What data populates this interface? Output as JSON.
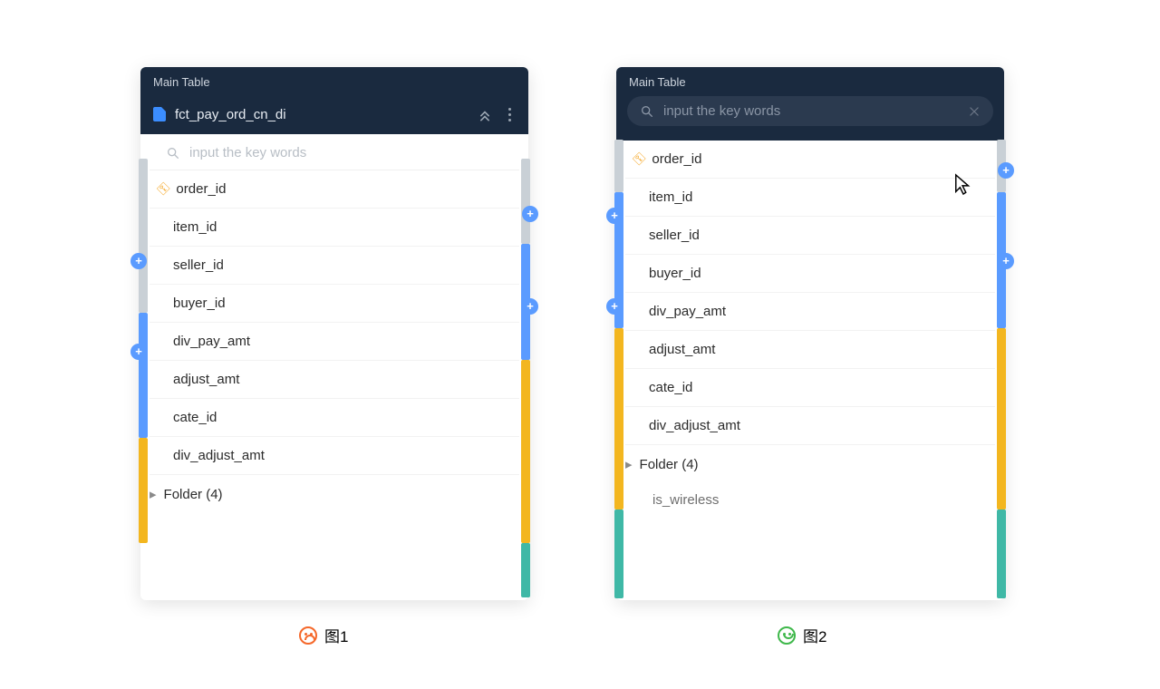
{
  "panelLeft": {
    "title": "Main Table",
    "tableName": "fct_pay_ord_cn_di",
    "search_placeholder": "input the key words",
    "fields": {
      "key": "order_id",
      "f1": "item_id",
      "f2": "seller_id",
      "f3": "buyer_id",
      "f4": "div_pay_amt",
      "f5": "adjust_amt",
      "f6": "cate_id",
      "f7": "div_adjust_amt",
      "folder": "Folder (4)"
    },
    "caption": "图1"
  },
  "panelRight": {
    "title": "Main Table",
    "search_placeholder": "input the key words",
    "fields": {
      "key": "order_id",
      "f1": "item_id",
      "f2": "seller_id",
      "f3": "buyer_id",
      "f4": "div_pay_amt",
      "f5": "adjust_amt",
      "f6": "cate_id",
      "f7": "div_adjust_amt",
      "folder": "Folder (4)",
      "sub1": "is_wireless"
    },
    "caption": "图2"
  }
}
